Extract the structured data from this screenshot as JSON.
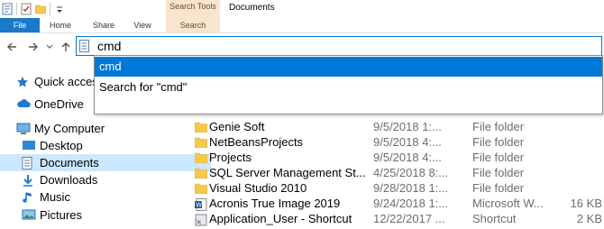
{
  "window": {
    "title": "Documents",
    "context_group": "Search Tools"
  },
  "ribbon": {
    "tabs": [
      {
        "label": "File"
      },
      {
        "label": "Home"
      },
      {
        "label": "Share"
      },
      {
        "label": "View"
      },
      {
        "label": "Search"
      }
    ]
  },
  "address_bar": {
    "value": "cmd",
    "back_icon": "arrow-left-icon",
    "forward_icon": "arrow-right-icon",
    "recent_icon": "chevron-down-icon",
    "up_icon": "arrow-up-icon"
  },
  "autocomplete": {
    "items": [
      {
        "label": "cmd"
      },
      {
        "label": "Search for \"cmd\""
      }
    ]
  },
  "nav_pane": {
    "items": [
      {
        "label": "Quick access",
        "icon": "star-icon"
      },
      {
        "label": "OneDrive",
        "icon": "cloud-icon"
      },
      {
        "label": "My Computer",
        "icon": "computer-icon"
      },
      {
        "label": "Desktop",
        "icon": "desktop-icon"
      },
      {
        "label": "Documents",
        "icon": "document-icon",
        "selected": true
      },
      {
        "label": "Downloads",
        "icon": "download-icon"
      },
      {
        "label": "Music",
        "icon": "music-icon"
      },
      {
        "label": "Pictures",
        "icon": "pictures-icon"
      }
    ]
  },
  "files": [
    {
      "name": "Genie Soft",
      "date": "9/5/2018 1:...",
      "type": "File folder",
      "size": "",
      "icon": "folder-icon"
    },
    {
      "name": "NetBeansProjects",
      "date": "9/5/2018 4:...",
      "type": "File folder",
      "size": "",
      "icon": "folder-icon"
    },
    {
      "name": "Projects",
      "date": "9/5/2018 4:...",
      "type": "File folder",
      "size": "",
      "icon": "folder-icon"
    },
    {
      "name": "SQL Server Management St...",
      "date": "4/25/2018 8:...",
      "type": "File folder",
      "size": "",
      "icon": "folder-icon"
    },
    {
      "name": "Visual Studio 2010",
      "date": "9/28/2018 1:...",
      "type": "File folder",
      "size": "",
      "icon": "folder-icon"
    },
    {
      "name": "Acronis True Image 2019",
      "date": "9/24/2018 1:...",
      "type": "Microsoft W...",
      "size": "16 KB",
      "icon": "word-document-icon"
    },
    {
      "name": "Application_User - Shortcut",
      "date": "12/22/2017 ...",
      "type": "Shortcut",
      "size": "2 KB",
      "icon": "shortcut-icon"
    }
  ],
  "colors": {
    "accent": "#0078d7",
    "file_tab": "#1979ca",
    "selection": "#cce8ff",
    "context_tab_bg": "#f8e5d0",
    "folder": "#f6c94a"
  }
}
